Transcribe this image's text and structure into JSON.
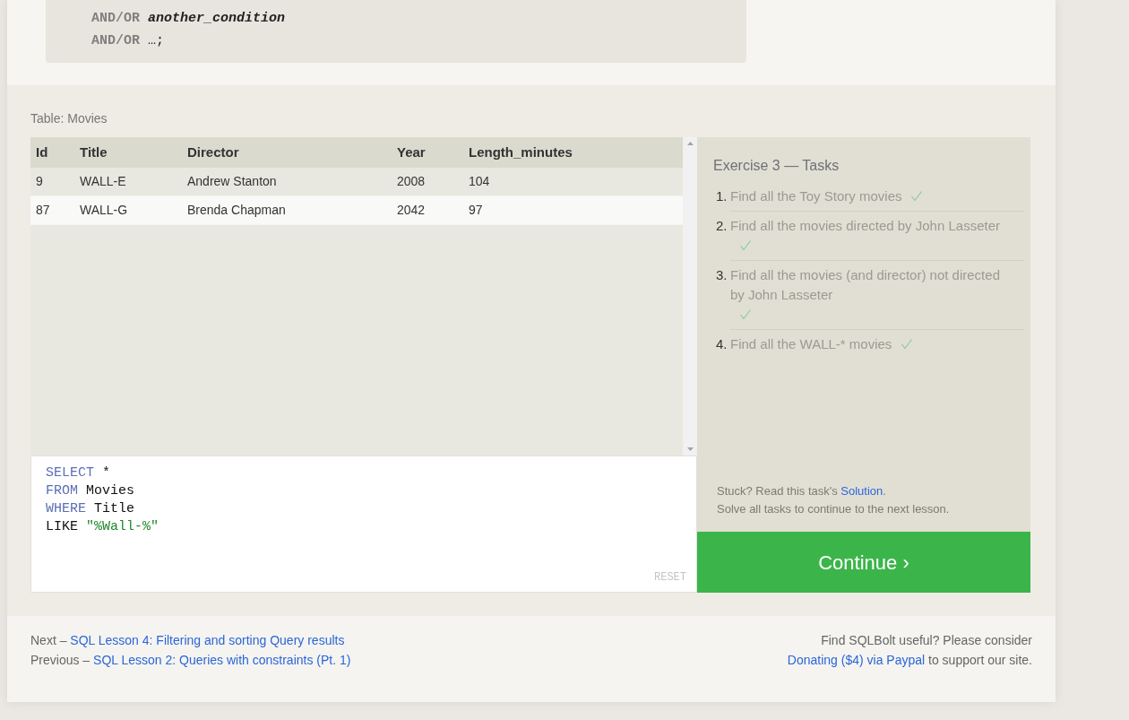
{
  "syntax_block": {
    "lines": [
      {
        "keyword": "AND/OR",
        "text": "another_condition",
        "kind": "placeholder"
      },
      {
        "keyword": "AND/OR",
        "text": "…;",
        "kind": "plain"
      }
    ]
  },
  "exercise": {
    "table_caption": "Table: Movies",
    "table": {
      "columns": [
        "Id",
        "Title",
        "Director",
        "Year",
        "Length_minutes"
      ],
      "rows": [
        [
          "9",
          "WALL-E",
          "Andrew Stanton",
          "2008",
          "104"
        ],
        [
          "87",
          "WALL-G",
          "Brenda Chapman",
          "2042",
          "97"
        ]
      ]
    },
    "editor": {
      "lines": [
        [
          {
            "text": "SELECT",
            "kind": "keyword"
          },
          {
            "text": " *",
            "kind": "plain"
          }
        ],
        [
          {
            "text": "FROM",
            "kind": "keyword"
          },
          {
            "text": " Movies",
            "kind": "plain"
          }
        ],
        [
          {
            "text": "WHERE",
            "kind": "keyword"
          },
          {
            "text": " Title",
            "kind": "plain"
          }
        ],
        [
          {
            "text": "LIKE ",
            "kind": "plain"
          },
          {
            "text": "\"%Wall-%\"",
            "kind": "string"
          }
        ]
      ],
      "reset": "RESET"
    },
    "tasks": {
      "title": "Exercise 3 — Tasks",
      "items": [
        {
          "number": "1.",
          "text": "Find all the Toy Story movies",
          "done": true
        },
        {
          "number": "2.",
          "text": "Find all the movies directed by John Lasseter",
          "done": true
        },
        {
          "number": "3.",
          "text": "Find all the movies (and director) not directed by John Lasseter",
          "done": true
        },
        {
          "number": "4.",
          "text": "Find all the WALL-* movies",
          "done": true
        }
      ]
    },
    "hint": {
      "prefix": "Stuck? Read this task's ",
      "link": "Solution",
      "suffix": "."
    },
    "note": "Solve all tasks to continue to the next lesson.",
    "continue_button": "Continue ›"
  },
  "footer": {
    "next": {
      "label": "Next – ",
      "link": "SQL Lesson 4: Filtering and sorting Query results"
    },
    "previous": {
      "label": "Previous – ",
      "link": "SQL Lesson 2: Queries with constraints (Pt. 1)"
    },
    "support": {
      "line": "Find SQLBolt useful? Please consider",
      "link": "Donating ($4) via Paypal",
      "suffix": " to support our site."
    }
  }
}
